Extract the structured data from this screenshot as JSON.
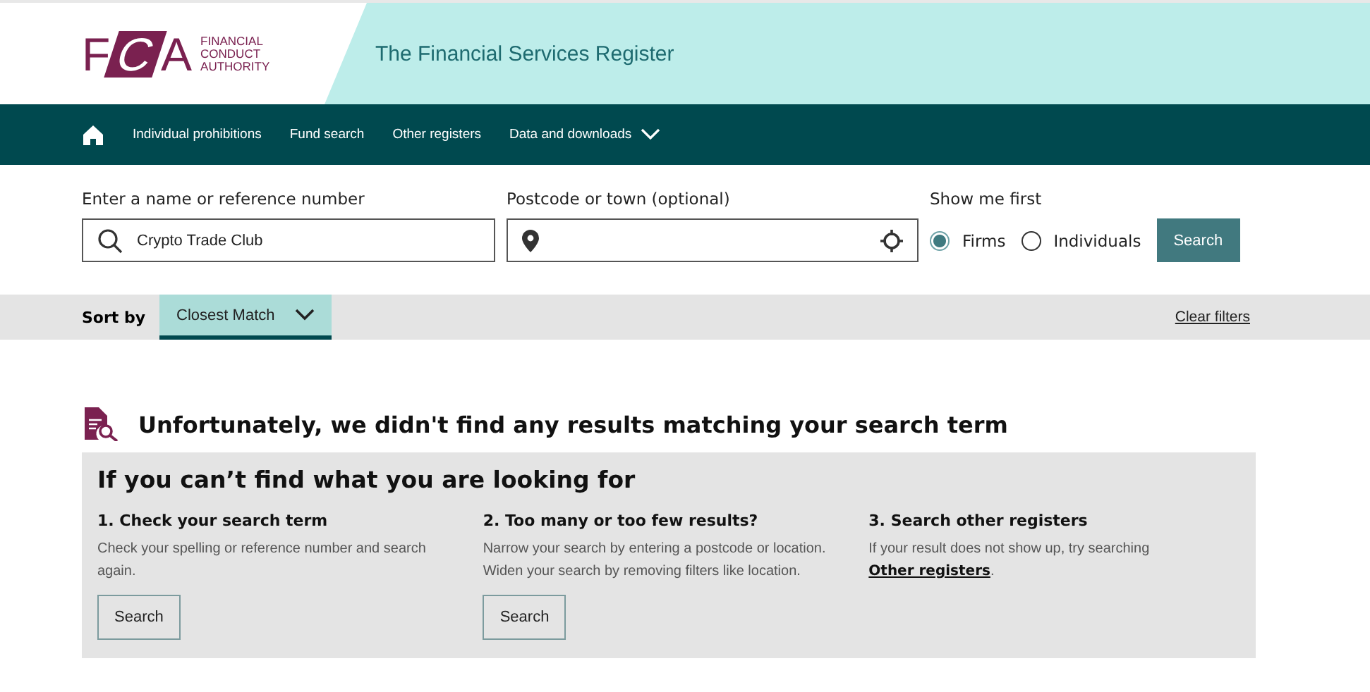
{
  "logo": {
    "letters": [
      "F",
      "C",
      "A"
    ],
    "lines": [
      "FINANCIAL",
      "CONDUCT",
      "AUTHORITY"
    ]
  },
  "header": {
    "title": "The Financial Services Register"
  },
  "nav": {
    "items": [
      {
        "label": "Individual prohibitions",
        "dropdown": false
      },
      {
        "label": "Fund search",
        "dropdown": false
      },
      {
        "label": "Other registers",
        "dropdown": false
      },
      {
        "label": "Data and downloads",
        "dropdown": true
      }
    ]
  },
  "search": {
    "name_label": "Enter a name or reference number",
    "name_value": "Crypto Trade Club",
    "location_label": "Postcode or town (optional)",
    "show_label": "Show me first",
    "options": [
      {
        "label": "Firms",
        "selected": true
      },
      {
        "label": "Individuals",
        "selected": false
      }
    ],
    "button": "Search"
  },
  "sort": {
    "label": "Sort by",
    "value": "Closest Match",
    "clear": "Clear filters"
  },
  "message": "Unfortunately, we didn't find any results matching your search term",
  "help": {
    "title": "If you can’t find what you are looking for",
    "tips": [
      {
        "heading": "1. Check your search term",
        "text": "Check your spelling or reference number and search again.",
        "button": "Search"
      },
      {
        "heading": "2. Too many or too few results?",
        "text": "Narrow your search by entering a postcode or location. Widen your search by removing filters like location.",
        "button": "Search"
      },
      {
        "heading": "3. Search other registers",
        "text": "If your result does not show up, try searching ",
        "link": "Other registers",
        "after": "."
      }
    ]
  }
}
